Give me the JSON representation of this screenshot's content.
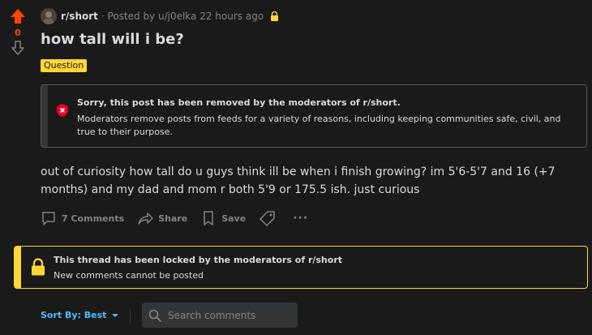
{
  "vote": {
    "count": "0"
  },
  "post": {
    "subreddit": "r/short",
    "posted_by": "· Posted by u/j0elka 22 hours ago",
    "title": "how tall will i be?",
    "flair": "Question",
    "body": "out of curiosity how tall do u guys think ill be when i finish growing? im 5'6-5'7 and 16 (+7 months) and my dad and mom r both 5'9 or 175.5 ish. just curious"
  },
  "removed_notice": {
    "title": "Sorry, this post has been removed by the moderators of r/short.",
    "text": "Moderators remove posts from feeds for a variety of reasons, including keeping communities safe, civil, and true to their purpose."
  },
  "actions": {
    "comments": "7 Comments",
    "share": "Share",
    "save": "Save",
    "more": "···"
  },
  "locked_notice": {
    "title": "This thread has been locked by the moderators of r/short",
    "text": "New comments cannot be posted"
  },
  "comments_bar": {
    "sort_label": "Sort By: Best",
    "search_placeholder": "Search comments"
  },
  "colors": {
    "upvote": "#ff4500",
    "flair": "#ffd635",
    "removed_icon": "#ea0027",
    "locked": "#ffd635",
    "sort": "#4fbcff"
  },
  "icons": [
    "upvote-arrow-icon",
    "downvote-arrow-icon",
    "lock-icon",
    "shield-x-icon",
    "comment-icon",
    "share-icon",
    "save-icon",
    "tag-icon",
    "more-icon",
    "caret-down-icon",
    "search-icon"
  ]
}
